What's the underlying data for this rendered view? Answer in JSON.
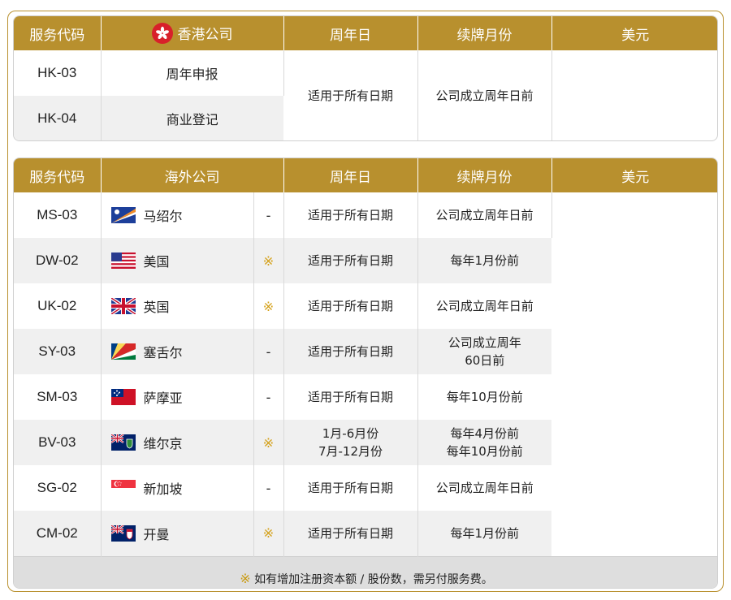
{
  "colors": {
    "header_bg": "#b8902e",
    "accent_mark": "#d4a017",
    "border": "#b8902e"
  },
  "hk_table": {
    "headers": [
      "服务代码",
      "香港公司",
      "周年日",
      "续牌月份",
      "美元"
    ],
    "rows": [
      {
        "code": "HK-03",
        "service": "周年申报"
      },
      {
        "code": "HK-04",
        "service": "商业登记"
      }
    ],
    "anniversary": "适用于所有日期",
    "renewal": "公司成立周年日前"
  },
  "offshore_table": {
    "headers": [
      "服务代码",
      "海外公司",
      "周年日",
      "续牌月份",
      "美元"
    ],
    "rows": [
      {
        "code": "MS-03",
        "country": "马绍尔",
        "flag": "marshall-islands-flag",
        "mark": "-",
        "anniversary": "适用于所有日期",
        "renewal": "公司成立周年日前"
      },
      {
        "code": "DW-02",
        "country": "美国",
        "flag": "usa-flag",
        "mark": "※",
        "anniversary": "适用于所有日期",
        "renewal": "每年1月份前"
      },
      {
        "code": "UK-02",
        "country": "英国",
        "flag": "uk-flag",
        "mark": "※",
        "anniversary": "适用于所有日期",
        "renewal": "公司成立周年日前"
      },
      {
        "code": "SY-03",
        "country": "塞舌尔",
        "flag": "seychelles-flag",
        "mark": "-",
        "anniversary": "适用于所有日期",
        "renewal_lines": [
          "公司成立周年",
          "60日前"
        ]
      },
      {
        "code": "SM-03",
        "country": "萨摩亚",
        "flag": "samoa-flag",
        "mark": "-",
        "anniversary": "适用于所有日期",
        "renewal": "每年10月份前"
      },
      {
        "code": "BV-03",
        "country": "维尔京",
        "flag": "bvi-flag",
        "mark": "※",
        "anniversary_lines": [
          "1月-6月份",
          "7月-12月份"
        ],
        "renewal_lines": [
          "每年4月份前",
          "每年10月份前"
        ]
      },
      {
        "code": "SG-02",
        "country": "新加坡",
        "flag": "singapore-flag",
        "mark": "-",
        "anniversary": "适用于所有日期",
        "renewal": "公司成立周年日前"
      },
      {
        "code": "CM-02",
        "country": "开曼",
        "flag": "cayman-flag",
        "mark": "※",
        "anniversary": "适用于所有日期",
        "renewal": "每年1月份前"
      }
    ],
    "footer": {
      "mark": "※",
      "text": " 如有增加注册资本额 / 股份数，需另付服务费。"
    }
  }
}
